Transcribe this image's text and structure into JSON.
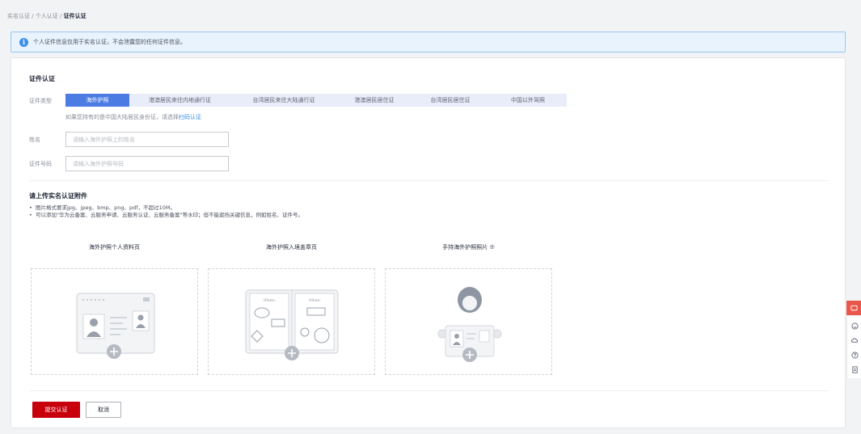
{
  "breadcrumb": {
    "item1": "实名认证",
    "sep": " / ",
    "item2": "个人认证",
    "current": "证件认证"
  },
  "notice": {
    "text": "个人证件信息仅用于实名认证，不会泄露您的任何证件信息。"
  },
  "form": {
    "section_title": "证件认证",
    "type_label": "证件类型",
    "tabs": [
      "海外护照",
      "港澳居民来往内地通行证",
      "台湾居民来往大陆通行证",
      "港澳居民居住证",
      "台湾居民居住证",
      "中国以外驾照"
    ],
    "active_tab": 0,
    "hint_prefix": "如果您持有的是中国大陆居民身份证，请选择",
    "hint_link": "扫码认证",
    "name_label": "姓名",
    "name_placeholder": "请输入海外护照上的姓名",
    "number_label": "证件号码",
    "number_placeholder": "请输入海外护照号码"
  },
  "upload": {
    "section_title": "请上传实名认证附件",
    "rules": [
      "图片格式要求jpg、jpeg、bmp、png、pdf，不超过10M。",
      "可以添加\"华为云备案、云服务申请、云服务认证、云服务备案\"等水印；但不能遮挡关键信息，例如姓名、证件号。"
    ],
    "boxes": [
      {
        "label": "海外护照个人资料页"
      },
      {
        "label": "海外护照入境盖章页"
      },
      {
        "label": "手持海外护照照片 ⑦"
      }
    ],
    "visa_text": "-Visas-"
  },
  "actions": {
    "submit": "提交认证",
    "cancel": "取消"
  },
  "colors": {
    "primary": "#c7000b",
    "tab_active": "#4c7ce3",
    "link": "#3d8fea"
  },
  "side_tools": [
    "chat-icon",
    "smile-icon",
    "cloud-icon",
    "help-icon",
    "doc-icon"
  ]
}
